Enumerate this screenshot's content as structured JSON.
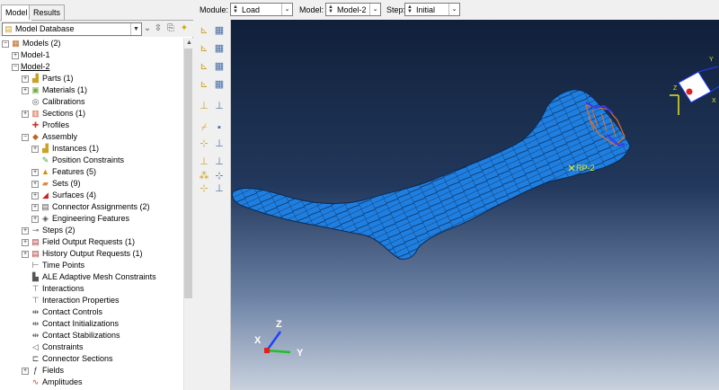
{
  "tabs": [
    "Model",
    "Results"
  ],
  "database": {
    "value": "Model Database"
  },
  "context": {
    "module_label": "Module:",
    "module_value": "Load",
    "model_label": "Model:",
    "model_value": "Model-2",
    "step_label": "Step:",
    "step_value": "Initial"
  },
  "tree": [
    {
      "label": "Models (2)",
      "icon": "models-icon",
      "expander": "minus"
    },
    {
      "label": "Model-1",
      "icon": "",
      "expander": "plus"
    },
    {
      "label": "Model-2",
      "icon": "",
      "expander": "minus"
    },
    {
      "label": "Parts (1)",
      "icon": "parts-icon",
      "expander": "plus"
    },
    {
      "label": "Materials (1)",
      "icon": "materials-icon",
      "expander": "plus"
    },
    {
      "label": "Calibrations",
      "icon": "calibrations-icon",
      "expander": ""
    },
    {
      "label": "Sections (1)",
      "icon": "sections-icon",
      "expander": "plus"
    },
    {
      "label": "Profiles",
      "icon": "profiles-icon",
      "expander": ""
    },
    {
      "label": "Assembly",
      "icon": "assembly-icon",
      "expander": "minus"
    },
    {
      "label": "Instances (1)",
      "icon": "instances-icon",
      "expander": "plus"
    },
    {
      "label": "Position Constraints",
      "icon": "position-constraints-icon",
      "expander": ""
    },
    {
      "label": "Features (5)",
      "icon": "features-icon",
      "expander": "plus"
    },
    {
      "label": "Sets (9)",
      "icon": "sets-icon",
      "expander": "plus"
    },
    {
      "label": "Surfaces (4)",
      "icon": "surfaces-icon",
      "expander": "plus"
    },
    {
      "label": "Connector Assignments (2)",
      "icon": "connector-assignments-icon",
      "expander": "plus"
    },
    {
      "label": "Engineering Features",
      "icon": "engineering-features-icon",
      "expander": "plus"
    },
    {
      "label": "Steps (2)",
      "icon": "steps-icon",
      "expander": "plus"
    },
    {
      "label": "Field Output Requests (1)",
      "icon": "field-output-icon",
      "expander": "plus"
    },
    {
      "label": "History Output Requests (1)",
      "icon": "history-output-icon",
      "expander": "plus"
    },
    {
      "label": "Time Points",
      "icon": "time-points-icon",
      "expander": ""
    },
    {
      "label": "ALE Adaptive Mesh Constraints",
      "icon": "ale-mesh-icon",
      "expander": ""
    },
    {
      "label": "Interactions",
      "icon": "interactions-icon",
      "expander": ""
    },
    {
      "label": "Interaction Properties",
      "icon": "interaction-properties-icon",
      "expander": ""
    },
    {
      "label": "Contact Controls",
      "icon": "contact-controls-icon",
      "expander": ""
    },
    {
      "label": "Contact Initializations",
      "icon": "contact-initializations-icon",
      "expander": ""
    },
    {
      "label": "Contact Stabilizations",
      "icon": "contact-stabilizations-icon",
      "expander": ""
    },
    {
      "label": "Constraints",
      "icon": "constraints-icon",
      "expander": ""
    },
    {
      "label": "Connector Sections",
      "icon": "connector-sections-icon",
      "expander": ""
    },
    {
      "label": "Fields",
      "icon": "fields-icon",
      "expander": "plus"
    },
    {
      "label": "Amplitudes",
      "icon": "amplitudes-icon",
      "expander": ""
    }
  ],
  "viewport": {
    "rp_label": "RP-2",
    "triad_labels": {
      "x": "X",
      "y": "Y",
      "z": "Z"
    },
    "corner_triad_labels": {
      "x": "X",
      "y": "Y",
      "z": "Z"
    },
    "colors": {
      "mesh": "#1f7fe0",
      "load": "#e0702a",
      "bc": "#3a3af0",
      "rp": "#e8e820"
    }
  },
  "toolbox_icons": [
    "create-load-icon",
    "load-manager-icon",
    "create-bc-icon",
    "bc-manager-icon",
    "create-predefined-field-icon",
    "predefined-field-manager-icon",
    "create-load-case-icon",
    "load-case-manager-icon",
    "create-datum-point-icon",
    "datum-manager-icon",
    "partition-icon",
    "query-icon",
    "create-set-icon",
    "create-surface-icon",
    "create-amplitude-icon",
    "special-options-icon",
    "csys-icon",
    "axis-icon",
    "translate-icon",
    "rotate-icon"
  ]
}
